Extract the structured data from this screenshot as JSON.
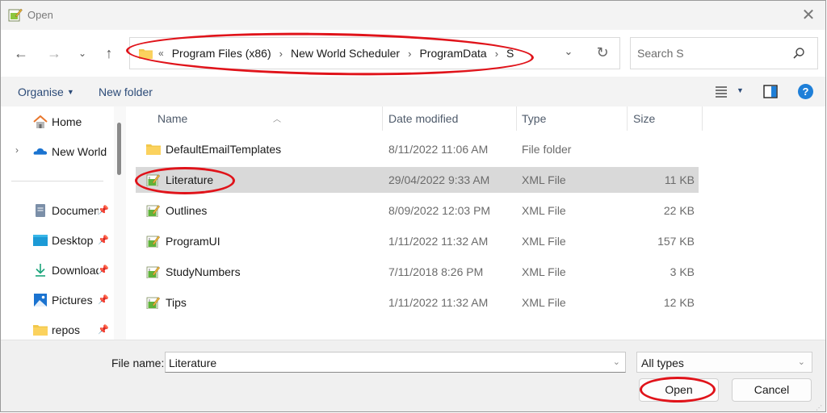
{
  "window": {
    "title": "Open",
    "app_icon": "notepad-edit-icon",
    "close_icon": "close-icon"
  },
  "nav": {
    "back_icon": "arrow-left-icon",
    "forward_icon": "arrow-right-icon",
    "recent_icon": "chevron-down-icon",
    "up_icon": "arrow-up-icon",
    "address": {
      "overflow": "«",
      "crumbs": [
        "Program Files (x86)",
        "New World Scheduler",
        "ProgramData",
        "S"
      ],
      "separator": "›"
    },
    "refresh_icon": "refresh-icon",
    "search": {
      "placeholder": "Search S",
      "value": ""
    }
  },
  "toolbar": {
    "organise_label": "Organise",
    "new_folder_label": "New folder",
    "view_icon": "list-view-icon",
    "preview_icon": "preview-pane-icon",
    "help_label": "?"
  },
  "sidebar": {
    "items": [
      {
        "label": "Home",
        "icon": "home-icon",
        "pinned": false,
        "expandable": false
      },
      {
        "label": "New World",
        "icon": "onedrive-cloud-icon",
        "pinned": false,
        "expandable": true
      },
      {
        "label": "Documents",
        "icon": "documents-icon",
        "pinned": true,
        "expandable": false
      },
      {
        "label": "Desktop",
        "icon": "desktop-icon",
        "pinned": true,
        "expandable": false
      },
      {
        "label": "Downloads",
        "icon": "download-icon",
        "pinned": true,
        "expandable": false
      },
      {
        "label": "Pictures",
        "icon": "pictures-icon",
        "pinned": true,
        "expandable": false
      },
      {
        "label": "repos",
        "icon": "folder-icon",
        "pinned": true,
        "expandable": false
      }
    ]
  },
  "filelist": {
    "columns": {
      "name": "Name",
      "date": "Date modified",
      "type": "Type",
      "size": "Size"
    },
    "rows": [
      {
        "name": "DefaultEmailTemplates",
        "date": "8/11/2022 11:06 AM",
        "type": "File folder",
        "size": "",
        "icon": "folder-icon",
        "selected": false
      },
      {
        "name": "Literature",
        "date": "29/04/2022 9:33 AM",
        "type": "XML File",
        "size": "11 KB",
        "icon": "xml-file-icon",
        "selected": true
      },
      {
        "name": "Outlines",
        "date": "8/09/2022 12:03 PM",
        "type": "XML File",
        "size": "22 KB",
        "icon": "xml-file-icon",
        "selected": false
      },
      {
        "name": "ProgramUI",
        "date": "1/11/2022 11:32 AM",
        "type": "XML File",
        "size": "157 KB",
        "icon": "xml-file-icon",
        "selected": false
      },
      {
        "name": "StudyNumbers",
        "date": "7/11/2018 8:26 PM",
        "type": "XML File",
        "size": "3 KB",
        "icon": "xml-file-icon",
        "selected": false
      },
      {
        "name": "Tips",
        "date": "1/11/2022 11:32 AM",
        "type": "XML File",
        "size": "12 KB",
        "icon": "xml-file-icon",
        "selected": false
      }
    ]
  },
  "footer": {
    "file_name_label": "File name:",
    "file_name_value": "Literature",
    "file_type_value": "All types",
    "open_label": "Open",
    "cancel_label": "Cancel"
  },
  "colors": {
    "annotation_red": "#e0131a",
    "selection_gray": "#d9d9d9",
    "link_blue": "#2c4b78",
    "help_blue": "#1e7fd8"
  }
}
